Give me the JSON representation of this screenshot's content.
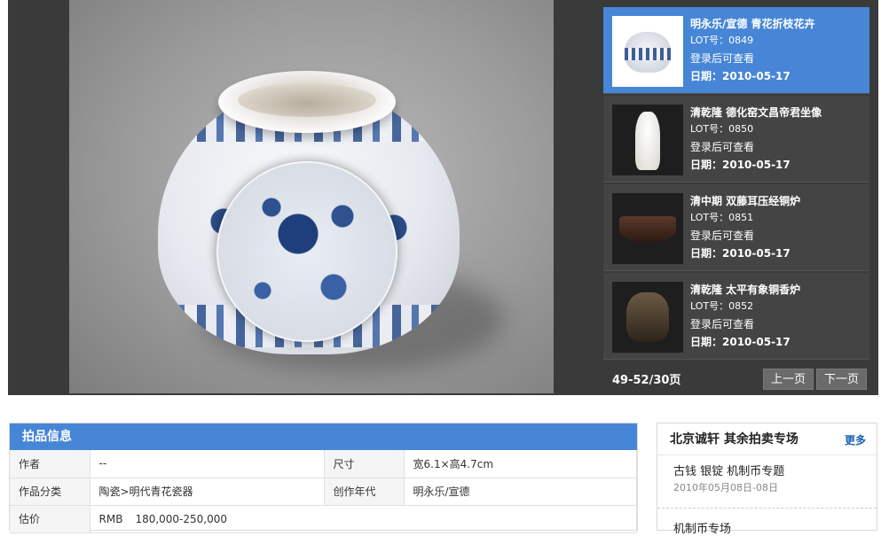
{
  "lots": [
    {
      "title": "明永乐/宣德  青花折枝花卉",
      "lot_label": "LOT号：0849",
      "login_text": "登录后可查看",
      "date_label": "日期：2010-05-17",
      "active": true,
      "thumb": "blue-white-jar"
    },
    {
      "title": "清乾隆  德化窑文昌帝君坐像",
      "lot_label": "LOT号：0850",
      "login_text": "登录后可查看",
      "date_label": "日期：2010-05-17",
      "active": false,
      "thumb": "seated-figure"
    },
    {
      "title": "清中期  双藤耳压经铜炉",
      "lot_label": "LOT号：0851",
      "login_text": "登录后可查看",
      "date_label": "日期：2010-05-17",
      "active": false,
      "thumb": "bronze-censer"
    },
    {
      "title": "清乾隆  太平有象铜香炉",
      "lot_label": "LOT号：0852",
      "login_text": "登录后可查看",
      "date_label": "日期：2010-05-17",
      "active": false,
      "thumb": "bronze-incense-burner"
    }
  ],
  "pager": {
    "info": "49-52/30页",
    "prev": "上一页",
    "next": "下一页"
  },
  "info": {
    "header": "拍品信息",
    "rows": [
      {
        "label1": "作者",
        "value1": "--",
        "label2": "尺寸",
        "value2": "宽6.1×高4.7cm"
      },
      {
        "label1": "作品分类",
        "value1": "陶瓷>明代青花瓷器",
        "label2": "创作年代",
        "value2": "明永乐/宣德"
      }
    ],
    "estimate_label": "估价",
    "estimate_currency": "RMB",
    "estimate_value": "180,000-250,000"
  },
  "sessions": {
    "title": "北京诚轩  其余拍卖专场",
    "more": "更多",
    "items": [
      {
        "name": "古钱  银锭  机制币专题",
        "date": "2010年05月08日-08日"
      }
    ],
    "next_item": "机制币专场"
  },
  "colors": {
    "accent": "#4786d6",
    "dark_bg": "#3a3a3a",
    "list_bg": "#444444",
    "price": "#cc0000"
  }
}
